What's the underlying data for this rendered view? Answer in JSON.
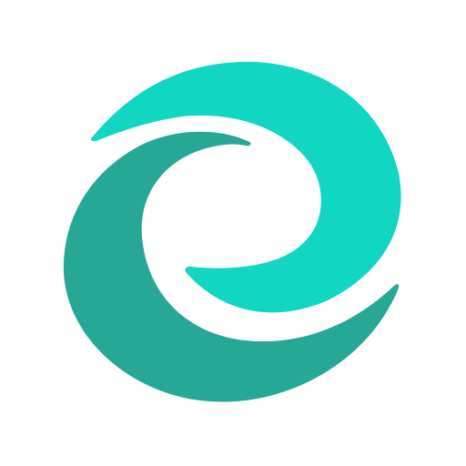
{
  "logo": {
    "name": "swirl-logo",
    "colors": {
      "background": "#ffffff",
      "light_swirl": "#11d6c2",
      "dark_swirl": "#27a896"
    }
  }
}
